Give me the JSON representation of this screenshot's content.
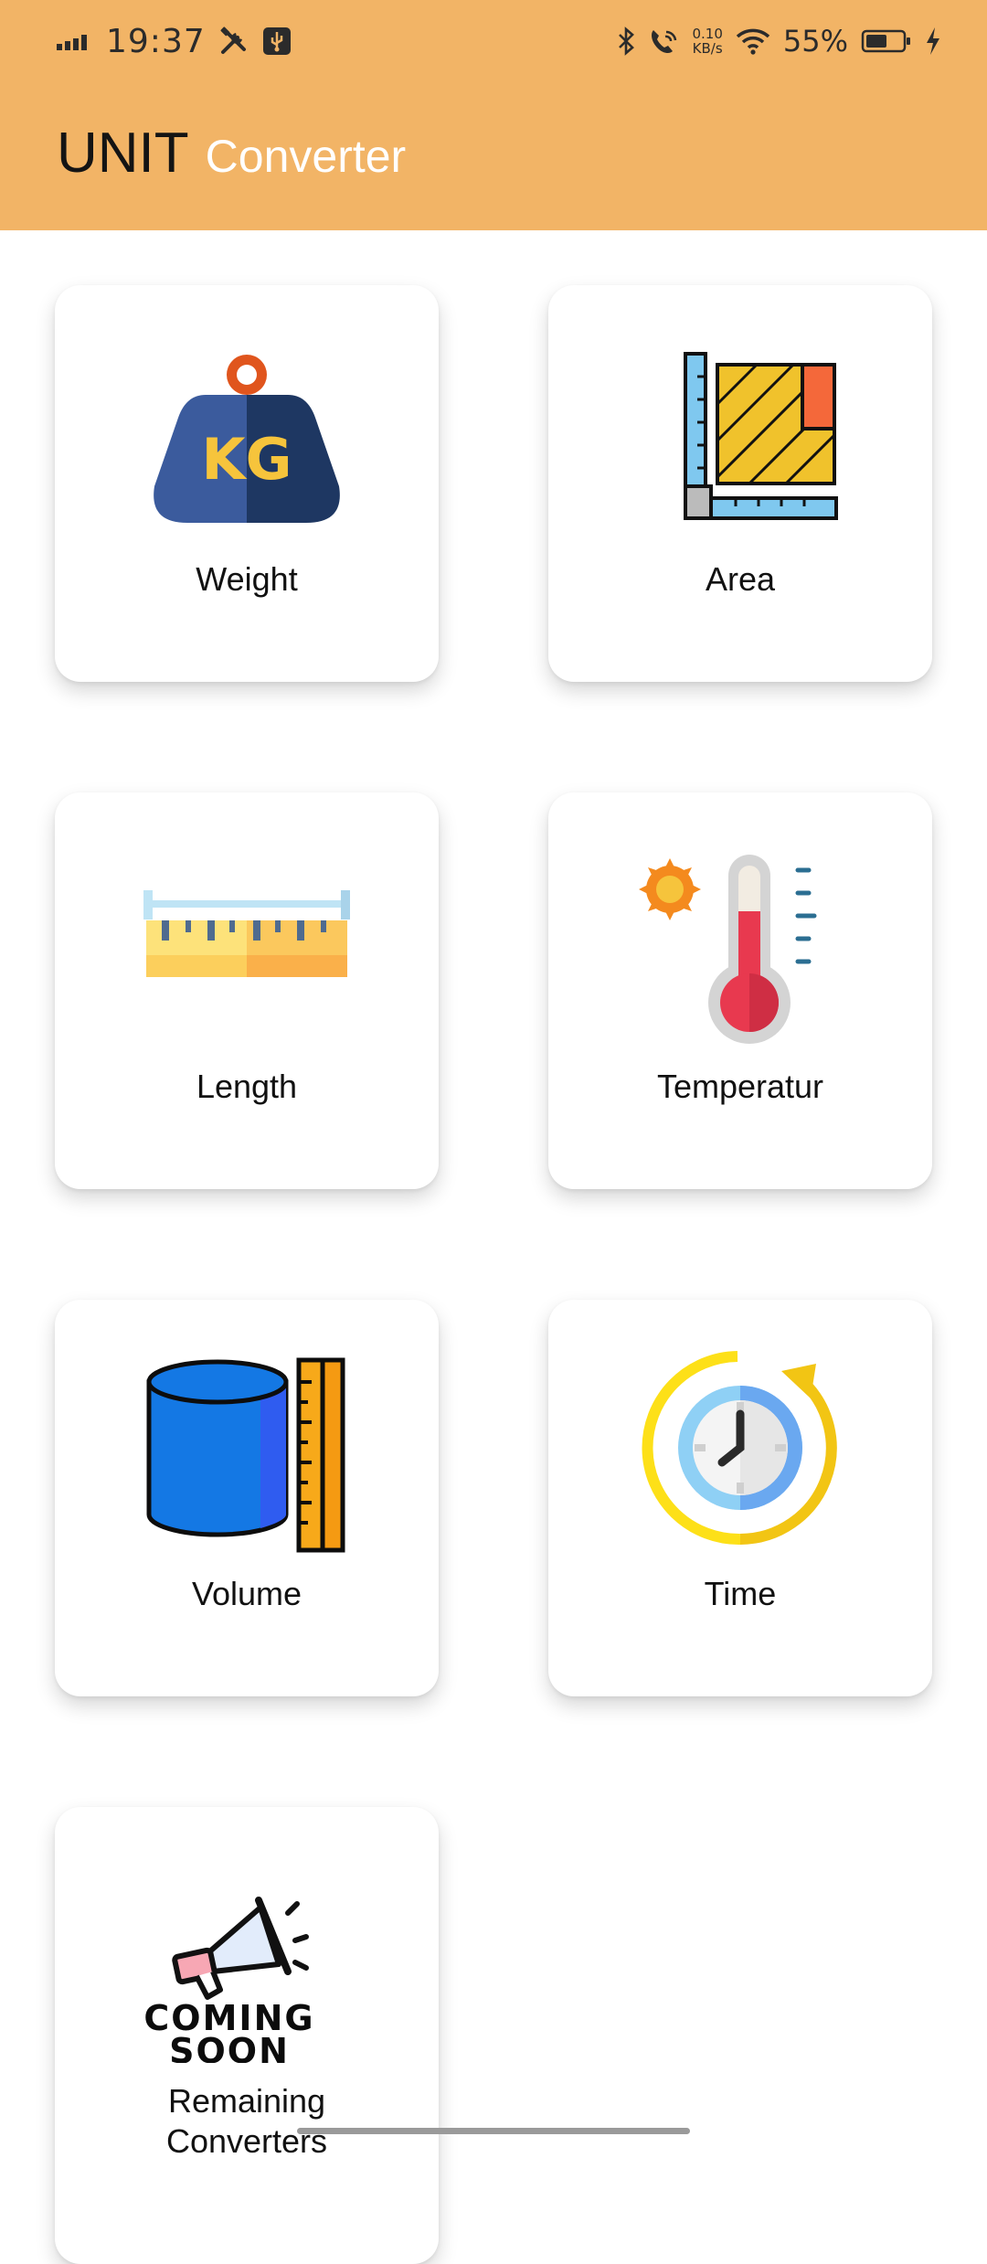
{
  "status_bar": {
    "time": "19:37",
    "net_speed_value": "0.10",
    "net_speed_unit": "KB/s",
    "battery_percent": "55%",
    "icons": [
      "signal-icon",
      "tools-icon",
      "usb-debug-icon",
      "bluetooth-icon",
      "wifi-calling-icon",
      "wifi-icon",
      "battery-icon",
      "charging-icon"
    ]
  },
  "header": {
    "title_main": "UNIT",
    "title_sub": "Converter",
    "background_color": "#f2b466"
  },
  "converters": [
    {
      "label": "Weight",
      "icon": "weight-kg-icon",
      "icon_text": "KG"
    },
    {
      "label": "Area",
      "icon": "area-ruler-icon"
    },
    {
      "label": "Length",
      "icon": "tape-ruler-icon"
    },
    {
      "label": "Temperatur",
      "icon": "thermometer-icon"
    },
    {
      "label": "Volume",
      "icon": "cylinder-ruler-icon"
    },
    {
      "label": "Time",
      "icon": "clock-refresh-icon"
    },
    {
      "label": "Remaining Converters",
      "icon": "coming-soon-megaphone-icon",
      "icon_text_line1": "COMING",
      "icon_text_line2": "SOON"
    }
  ]
}
